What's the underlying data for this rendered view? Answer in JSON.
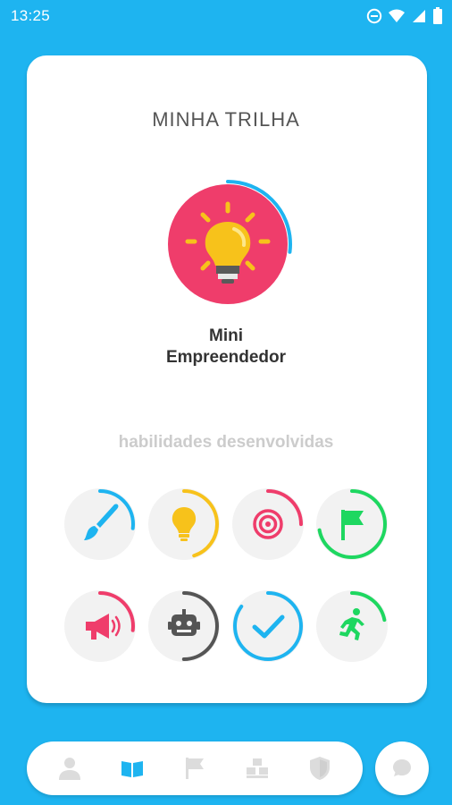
{
  "status_bar": {
    "time": "13:25",
    "icons": [
      "do-not-disturb-icon",
      "wifi-icon",
      "signal-icon",
      "battery-icon"
    ]
  },
  "card": {
    "title": "MINHA TRILHA",
    "hero": {
      "name": "Mini Empreendedor",
      "icon": "lightbulb-icon",
      "badge_color": "#ef3d6b",
      "ring_color": "#1eb4f0",
      "progress": 0.27
    },
    "skills_title": "habilidades desenvolvidas",
    "skills": [
      {
        "icon": "paintbrush-icon",
        "color": "#1eb4f0",
        "progress": 0.27
      },
      {
        "icon": "lightbulb-icon",
        "color": "#f7c21b",
        "progress": 0.45
      },
      {
        "icon": "target-icon",
        "color": "#ef3d6b",
        "progress": 0.25
      },
      {
        "icon": "flag-icon",
        "color": "#1ed760",
        "progress": 0.72
      },
      {
        "icon": "megaphone-icon",
        "color": "#ef3d6b",
        "progress": 0.27
      },
      {
        "icon": "robot-icon",
        "color": "#555555",
        "progress": 0.5
      },
      {
        "icon": "checkmark-icon",
        "color": "#1eb4f0",
        "progress": 0.85
      },
      {
        "icon": "running-person-icon",
        "color": "#1ed760",
        "progress": 0.22
      }
    ]
  },
  "bottom_nav": {
    "items": [
      {
        "icon": "profile-icon",
        "active": false
      },
      {
        "icon": "book-icon",
        "active": true
      },
      {
        "icon": "flag-icon",
        "active": false
      },
      {
        "icon": "blocks-icon",
        "active": false
      },
      {
        "icon": "shield-icon",
        "active": false
      }
    ],
    "chat_icon": "chat-bubble-icon"
  },
  "colors": {
    "background": "#1eb4f0",
    "card": "#ffffff",
    "inactive_icon": "#dcdcdc",
    "active_icon": "#1eb4f0",
    "skill_circle": "#f2f2f2"
  }
}
